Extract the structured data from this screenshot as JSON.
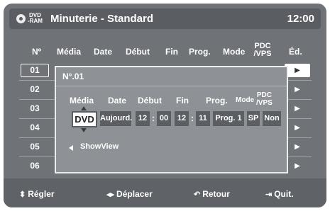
{
  "header": {
    "logo_top": "DVD",
    "logo_bottom": "-RAM",
    "title": "Minuterie - Standard",
    "clock": "12:00",
    "icon": "disc-icon"
  },
  "table": {
    "columns": [
      "Nº",
      "Média",
      "Date",
      "Début",
      "Fin",
      "Prog.",
      "Mode",
      "PDC /VPS",
      "Éd."
    ],
    "rows": [
      "01",
      "02",
      "03",
      "04",
      "05",
      "06"
    ],
    "selected_row": "01",
    "edit_icon": "▶"
  },
  "dialog": {
    "title": "N°.01",
    "headers": {
      "media": "Média",
      "date": "Date",
      "start": "Début",
      "end": "Fin",
      "prog": "Prog.",
      "mode": "Mode",
      "pdc_line1": "PDC",
      "pdc_line2": "/VPS"
    },
    "fields": {
      "media": "DVD",
      "date": "Aujourd.",
      "start_h": "12",
      "start_m": "00",
      "end_h": "12",
      "end_m": "11",
      "prog": "Prog. 1",
      "mode": "SP",
      "pdc": "Non"
    },
    "time_sep": ":",
    "showview": "ShowView"
  },
  "footer": {
    "adjust": "Régler",
    "move": "Déplacer",
    "back": "Retour",
    "quit": "Quit.",
    "adjust_icon": "⬍",
    "move_icon": "◂▸",
    "back_icon": "↶",
    "quit_icon": "⇥"
  },
  "colors": {
    "background": "#6f7378",
    "header": "#5a5d61",
    "field": "#5b5f63",
    "accent": "#ffffff"
  }
}
